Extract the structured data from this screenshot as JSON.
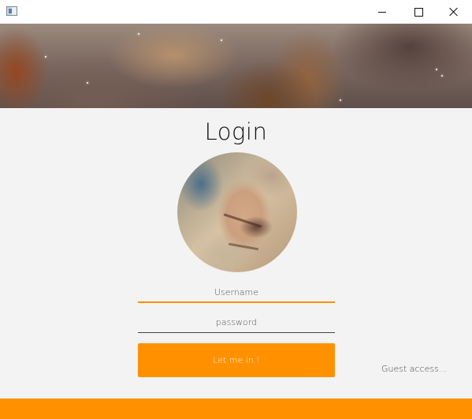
{
  "window": {
    "title": "",
    "controls": {
      "minimize_icon": "minimize-icon",
      "maximize_icon": "maximize-icon",
      "close_icon": "close-icon"
    }
  },
  "banner": {
    "description": "nebula-banner-image"
  },
  "login": {
    "title": "Login",
    "avatar_icon": "avatar-image",
    "username": {
      "value": "",
      "placeholder": "Username"
    },
    "password": {
      "value": "",
      "placeholder": "password"
    },
    "submit_label": "Let me in !",
    "guest_label": "Guest access..."
  },
  "colors": {
    "accent": "#ff9100",
    "background": "#f3f3f3",
    "titlebar": "#ffffff"
  }
}
